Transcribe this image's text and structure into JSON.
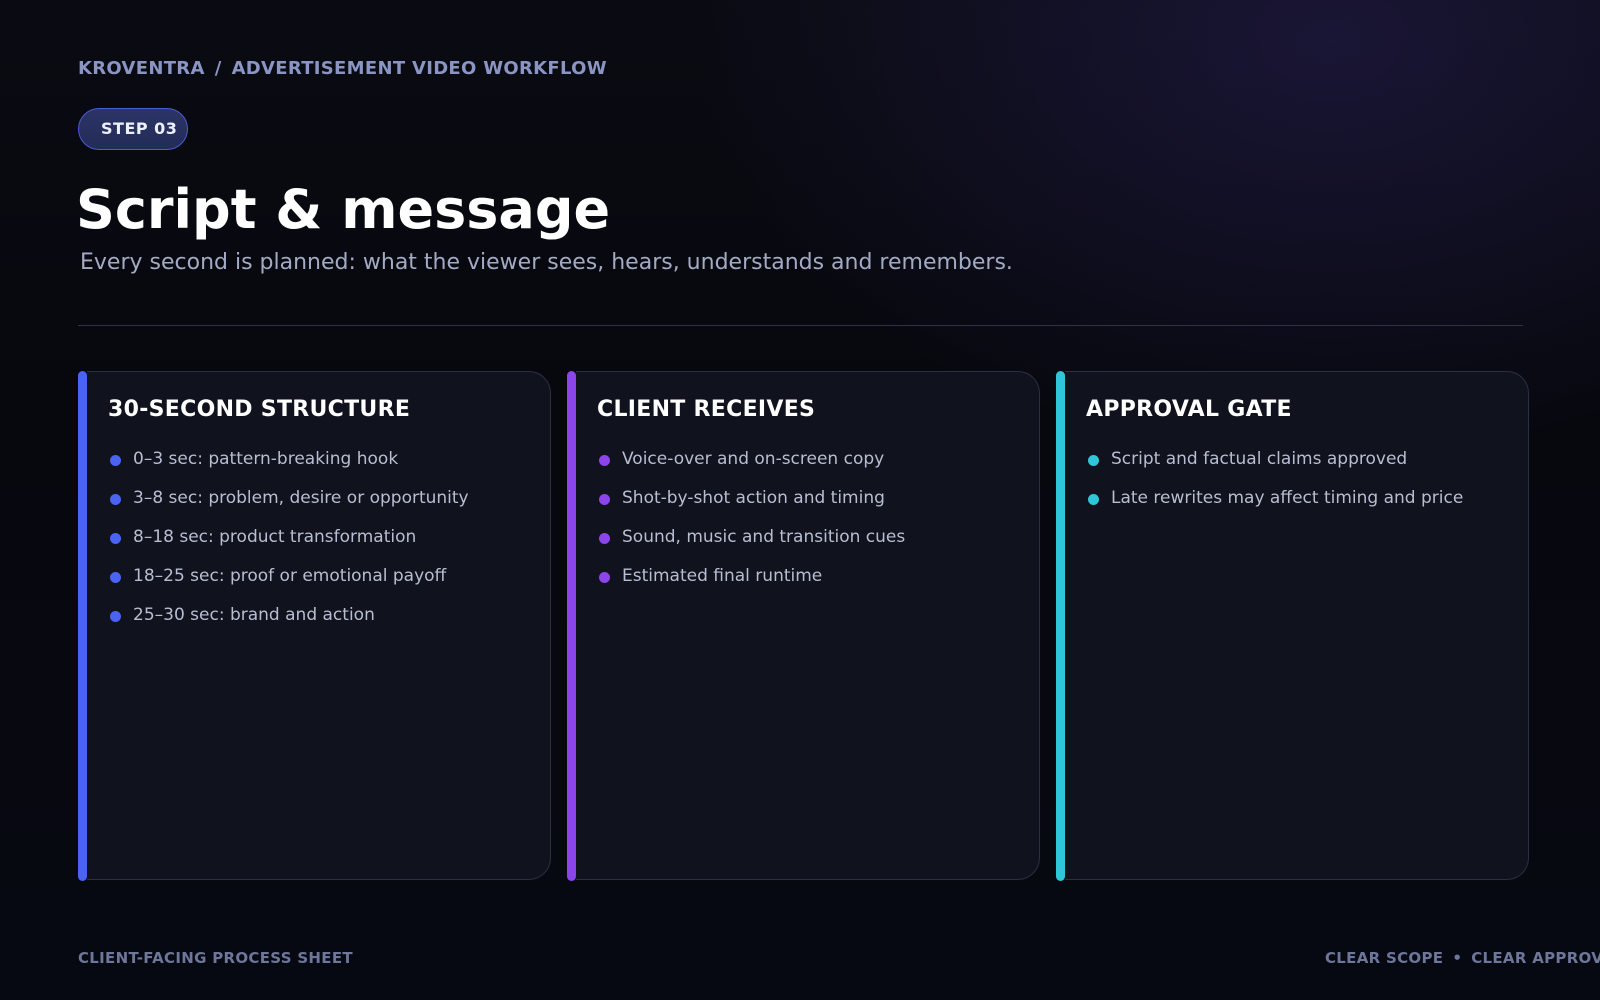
{
  "breadcrumb": {
    "brand": "KROVENTRA",
    "separator": "/",
    "section": "ADVERTISEMENT VIDEO WORKFLOW"
  },
  "step": "STEP 03",
  "title": "Script & message",
  "subtitle": "Every second is planned: what the viewer sees, hears, understands and remembers.",
  "colors": {
    "blue": "#4a63f0",
    "purple": "#8b45ea",
    "cyan": "#2ec6d8"
  },
  "cards": [
    {
      "title": "30-SECOND STRUCTURE",
      "items": [
        "0–3 sec: pattern-breaking hook",
        "3–8 sec: problem, desire or opportunity",
        "8–18 sec: product transformation",
        "18–25 sec: proof or emotional payoff",
        "25–30 sec: brand and action"
      ]
    },
    {
      "title": "CLIENT RECEIVES",
      "items": [
        "Voice-over and on-screen copy",
        "Shot-by-shot action and timing",
        "Sound, music and transition cues",
        "Estimated final runtime"
      ]
    },
    {
      "title": "APPROVAL GATE",
      "items": [
        "Script and factual claims approved",
        "Late rewrites may affect timing and price"
      ]
    }
  ],
  "footer": {
    "left": "CLIENT-FACING PROCESS SHEET",
    "right_1": "CLEAR SCOPE",
    "right_sep": "•",
    "right_2": "CLEAR APPROVALS"
  }
}
